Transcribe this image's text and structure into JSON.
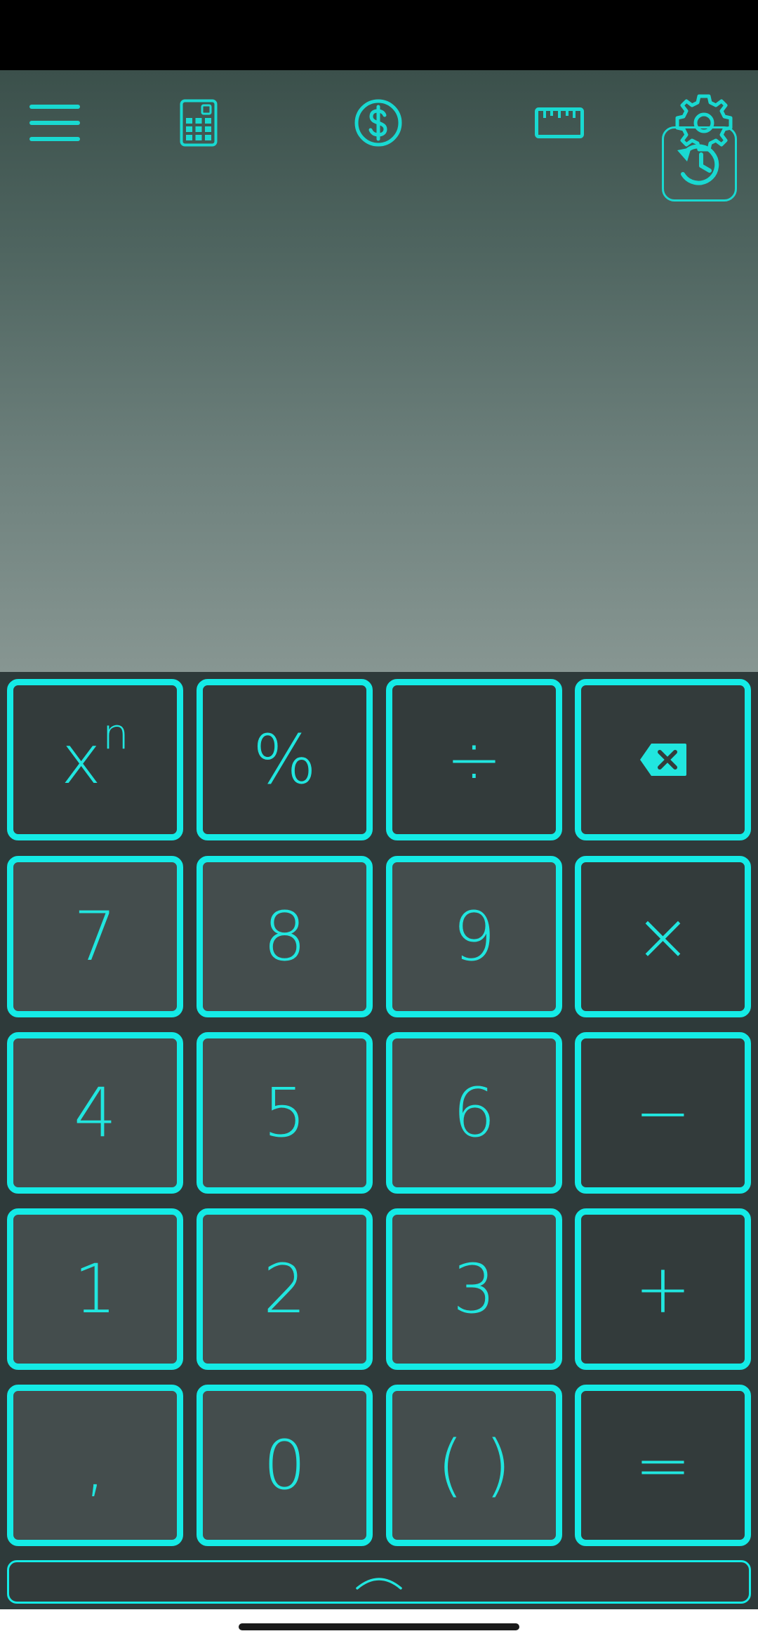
{
  "app": {
    "accent_color": "#14ebe6",
    "icon_color": "#19d9d1"
  },
  "toolbar": {
    "icons": [
      "hamburger-menu-icon",
      "calculator-icon",
      "dollar-currency-icon",
      "ruler-icon",
      "gear-icon"
    ]
  },
  "display": {
    "expression": "",
    "result": "",
    "history_icon": "history-icon"
  },
  "keypad": {
    "keys": {
      "power": "x",
      "power_sup": "n",
      "percent": "%",
      "divide": "÷",
      "backspace": "backspace-icon",
      "seven": "7",
      "eight": "8",
      "nine": "9",
      "multiply": "×",
      "four": "4",
      "five": "5",
      "six": "6",
      "minus": "−",
      "one": "1",
      "two": "2",
      "three": "3",
      "plus": "+",
      "comma": ",",
      "zero": "0",
      "parentheses": "( )",
      "equals": "="
    }
  },
  "expand": {
    "icon": "chevron-up-icon"
  }
}
